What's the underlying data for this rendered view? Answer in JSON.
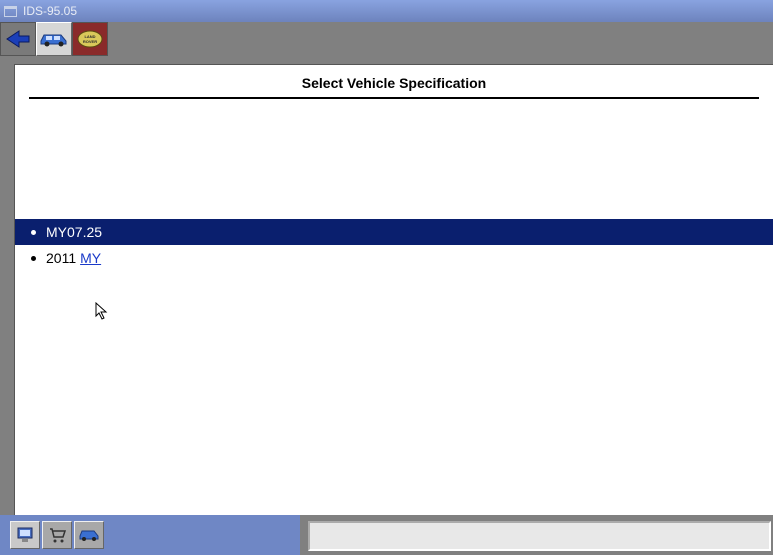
{
  "window": {
    "title": "IDS-95.05"
  },
  "top_toolbar": {
    "back_icon": "back-arrow",
    "vehicle_icon": "car",
    "hot_icon": "land-rover"
  },
  "panel": {
    "heading": "Select Vehicle Specification"
  },
  "list": {
    "items": [
      {
        "label": "MY07.25",
        "selected": true
      },
      {
        "label_prefix": "2011",
        "label_link": "MY",
        "selected": false
      }
    ]
  },
  "bottom_toolbar": {
    "btn1": "system-info",
    "btn2": "shopping-cart",
    "btn3": "vehicle-select"
  }
}
